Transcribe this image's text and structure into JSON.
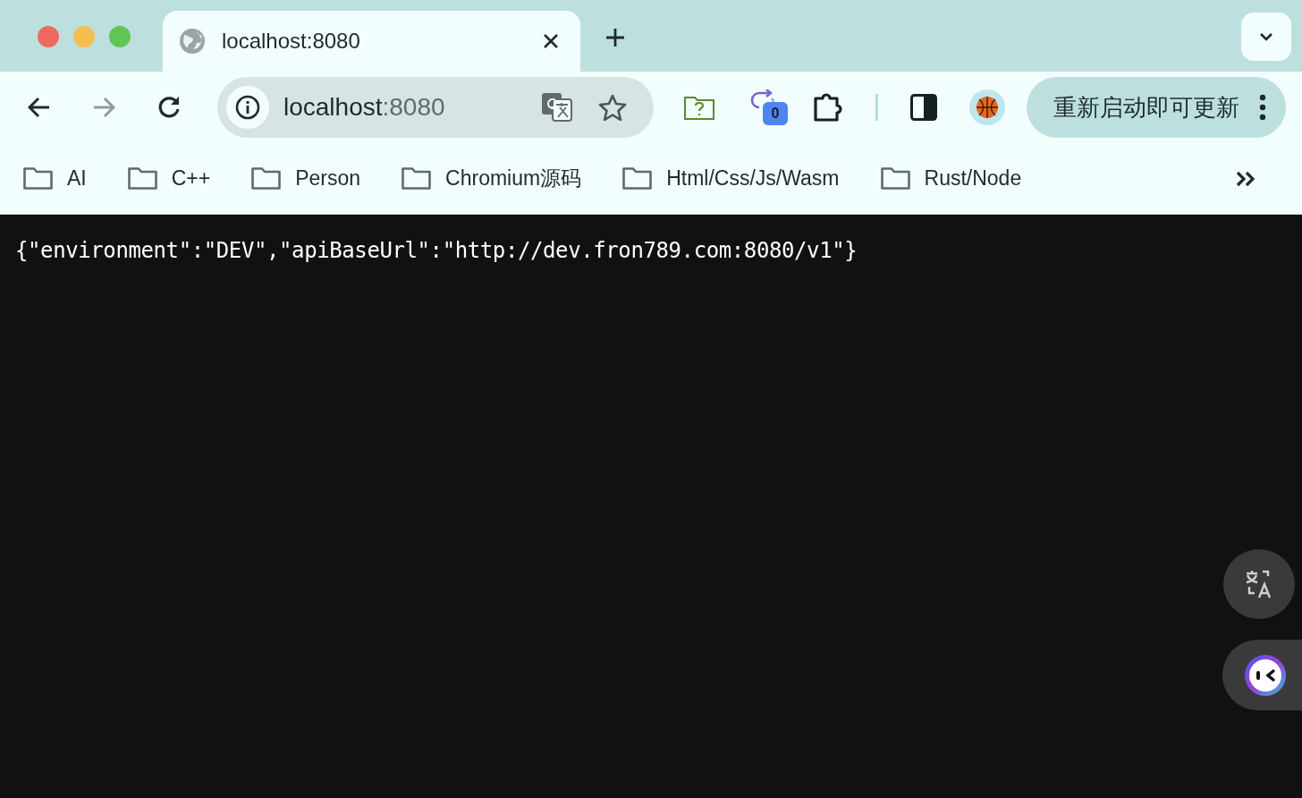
{
  "tabs": [
    {
      "title": "localhost:8080",
      "selected": true
    }
  ],
  "toolbar": {
    "nav_buttons": [
      {
        "kind": "back",
        "disabled": false
      },
      {
        "kind": "forward",
        "disabled": true
      },
      {
        "kind": "reload",
        "disabled": false
      }
    ],
    "address": {
      "host": "localhost",
      "port": ":8080"
    },
    "bookmarked": false,
    "extension_badge": "0",
    "update_button": "重新启动即可更新"
  },
  "bookmarks": [
    {
      "label": "AI"
    },
    {
      "label": "C++"
    },
    {
      "label": "Person"
    },
    {
      "label": "Chromium源码"
    },
    {
      "label": "Html/Css/Js/Wasm"
    },
    {
      "label": "Rust/Node"
    }
  ],
  "page": {
    "text": "{\"environment\":\"DEV\",\"apiBaseUrl\":\"http://dev.fron789.com:8080/v1\"}"
  }
}
